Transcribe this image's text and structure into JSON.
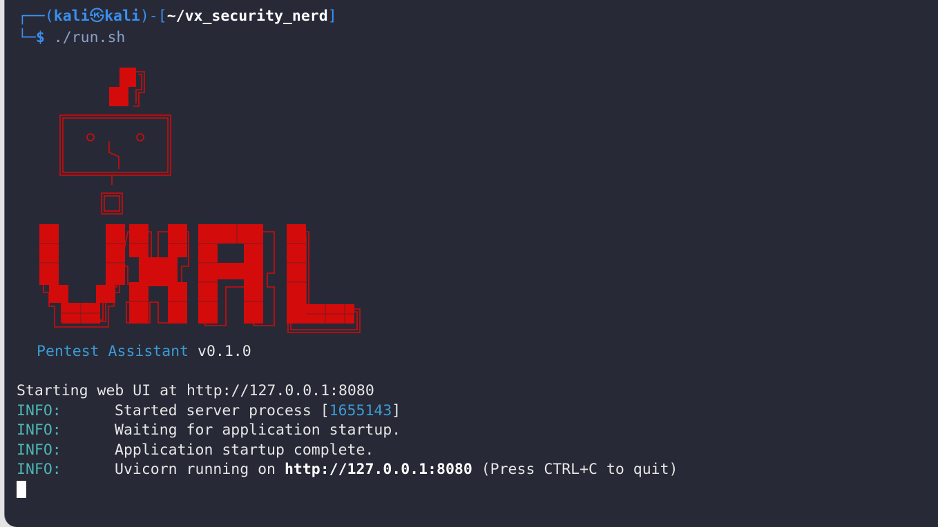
{
  "prompt": {
    "corner_top": "┌──(",
    "user": "kali",
    "skull_glyph": "㉿",
    "host": "kali",
    "sep": ")-[",
    "path": "~/vx_security_nerd",
    "close": "]",
    "corner_bottom": "└─",
    "dollar": "$",
    "command": "./run.sh"
  },
  "banner": {
    "logo_text": "VXRL",
    "subtitle": "Pentest Assistant",
    "version": "v0.1.0"
  },
  "output": {
    "startup": "Starting web UI at http://127.0.0.1:8080",
    "info_rows": [
      {
        "tag": "INFO:",
        "pre": "Started server process [",
        "pid": "1655143",
        "post": "]",
        "bold": "",
        "tail": ""
      },
      {
        "tag": "INFO:",
        "pre": "Waiting for application startup.",
        "pid": "",
        "post": "",
        "bold": "",
        "tail": ""
      },
      {
        "tag": "INFO:",
        "pre": "Application startup complete.",
        "pid": "",
        "post": "",
        "bold": "",
        "tail": ""
      },
      {
        "tag": "INFO:",
        "pre": "Uvicorn running on ",
        "pid": "",
        "post": "",
        "bold": "http://127.0.0.1:8080",
        "tail": " (Press CTRL+C to quit)"
      }
    ]
  },
  "colors": {
    "background": "#272a36",
    "logo_red": "#d40b0b",
    "prompt_blue": "#3a8ff0",
    "info_cyan": "#4cb6b6"
  }
}
